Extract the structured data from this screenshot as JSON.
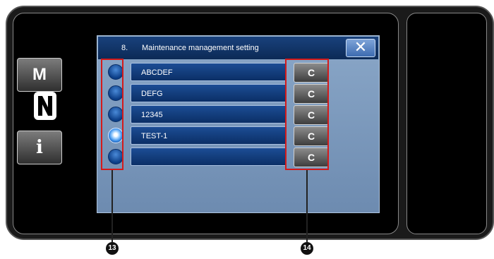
{
  "dialog": {
    "number": "8.",
    "title": "Maintenance management setting",
    "close_icon": "close-x-icon"
  },
  "rows": [
    {
      "name": "ABCDEF",
      "selected": false,
      "clear_label": "C"
    },
    {
      "name": "DEFG",
      "selected": false,
      "clear_label": "C"
    },
    {
      "name": "12345",
      "selected": false,
      "clear_label": "C"
    },
    {
      "name": "TEST-1",
      "selected": true,
      "clear_label": "C"
    },
    {
      "name": "",
      "selected": false,
      "clear_label": "C"
    }
  ],
  "side": {
    "m_label": "M",
    "info_label": "i"
  },
  "callouts": {
    "radio_group": "13",
    "clear_group": "14"
  },
  "colors": {
    "callout_box": "#d41a1a",
    "titlebar": "#0c2a56",
    "dialog_body": "#7c9abd"
  }
}
